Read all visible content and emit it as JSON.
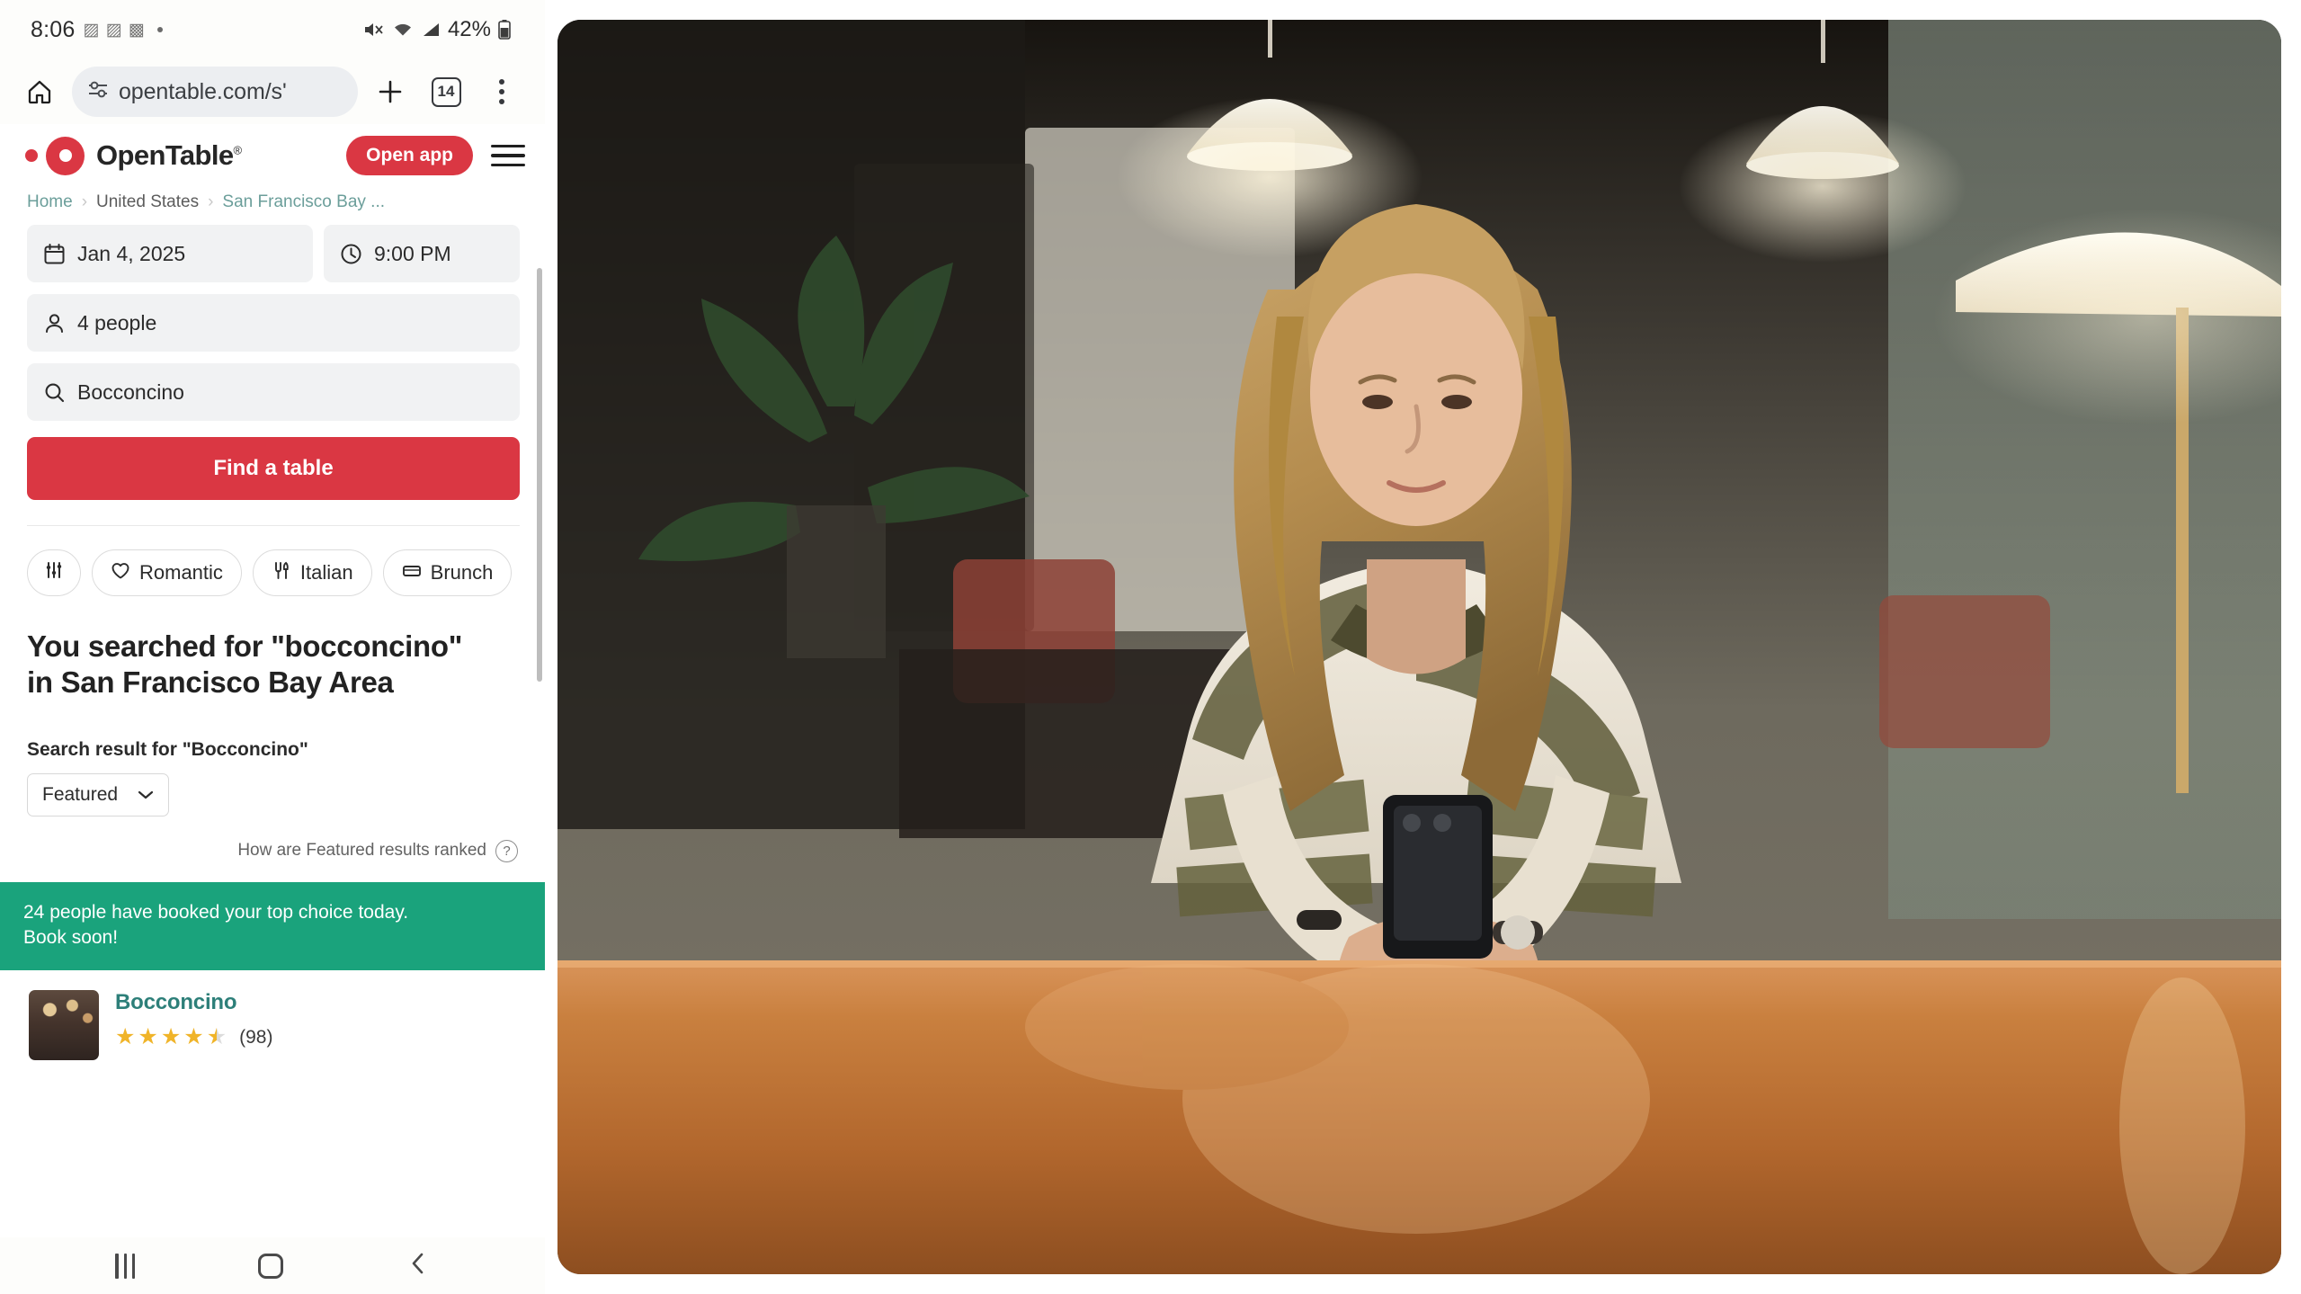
{
  "phone": {
    "status_bar": {
      "clock": "8:06",
      "glyphs": "▨ ▨ ▩",
      "battery_percent": "42%",
      "mute_icon": "volume-mute-icon",
      "wifi_icon": "wifi-icon",
      "signal_icon": "cellular-signal-icon",
      "battery_icon": "battery-icon"
    },
    "browser": {
      "home_icon": "home-icon",
      "site_settings_icon": "site-settings-icon",
      "url": "opentable.com/s'",
      "new_tab_icon": "plus-icon",
      "tab_count": "14",
      "menu_icon": "three-dot-menu-icon"
    },
    "nav_bar": {
      "recents_icon": "recents-icon",
      "home_icon": "home-square-icon",
      "back_icon": "back-chevron-icon"
    }
  },
  "site": {
    "brand": "OpenTable",
    "brand_registered": "®",
    "open_app_label": "Open app",
    "menu_icon": "hamburger-menu-icon",
    "accent_color": "#da3743",
    "breadcrumb": [
      {
        "label": "Home",
        "muted": false
      },
      {
        "label": "United States",
        "muted": true
      },
      {
        "label": "San Francisco Bay ...",
        "muted": false
      }
    ],
    "search_form": {
      "date_icon": "calendar-icon",
      "date_value": "Jan 4, 2025",
      "time_icon": "clock-icon",
      "time_value": "9:00 PM",
      "party_icon": "person-icon",
      "party_value": "4 people",
      "query_icon": "search-icon",
      "query_value": "Bocconcino",
      "submit_label": "Find a table"
    },
    "filter_chips": [
      {
        "icon": "filter-sliders-icon",
        "label": ""
      },
      {
        "icon": "heart-icon",
        "label": "Romantic"
      },
      {
        "icon": "cutlery-icon",
        "label": "Italian"
      },
      {
        "icon": "brunch-icon",
        "label": "Brunch"
      }
    ],
    "results": {
      "heading_line1": "You searched for \"bocconcino\"",
      "heading_line2": "in San Francisco Bay Area",
      "result_label": "Search result for \"Bocconcino\"",
      "sort_value": "Featured",
      "sort_chevron_icon": "chevron-down-icon",
      "ranked_text": "How are Featured results ranked",
      "ranked_help_icon": "question-mark-icon",
      "promo_line1": "24 people have booked your top choice today.",
      "promo_line2": "Book soon!",
      "promo_color": "#1aa37c",
      "restaurants": [
        {
          "name": "Bocconcino",
          "thumbnail": "restaurant-interior-thumbnail",
          "stars_filled": 4,
          "has_half_star": true,
          "star_icon": "star-icon",
          "review_count": "(98)"
        }
      ]
    }
  },
  "photo": {
    "alt_name": "woman-at-table-using-phone-photo",
    "description": "Woman with long blonde hair seated at a polished wood table looking at a smartphone in a warmly lit restaurant interior"
  }
}
